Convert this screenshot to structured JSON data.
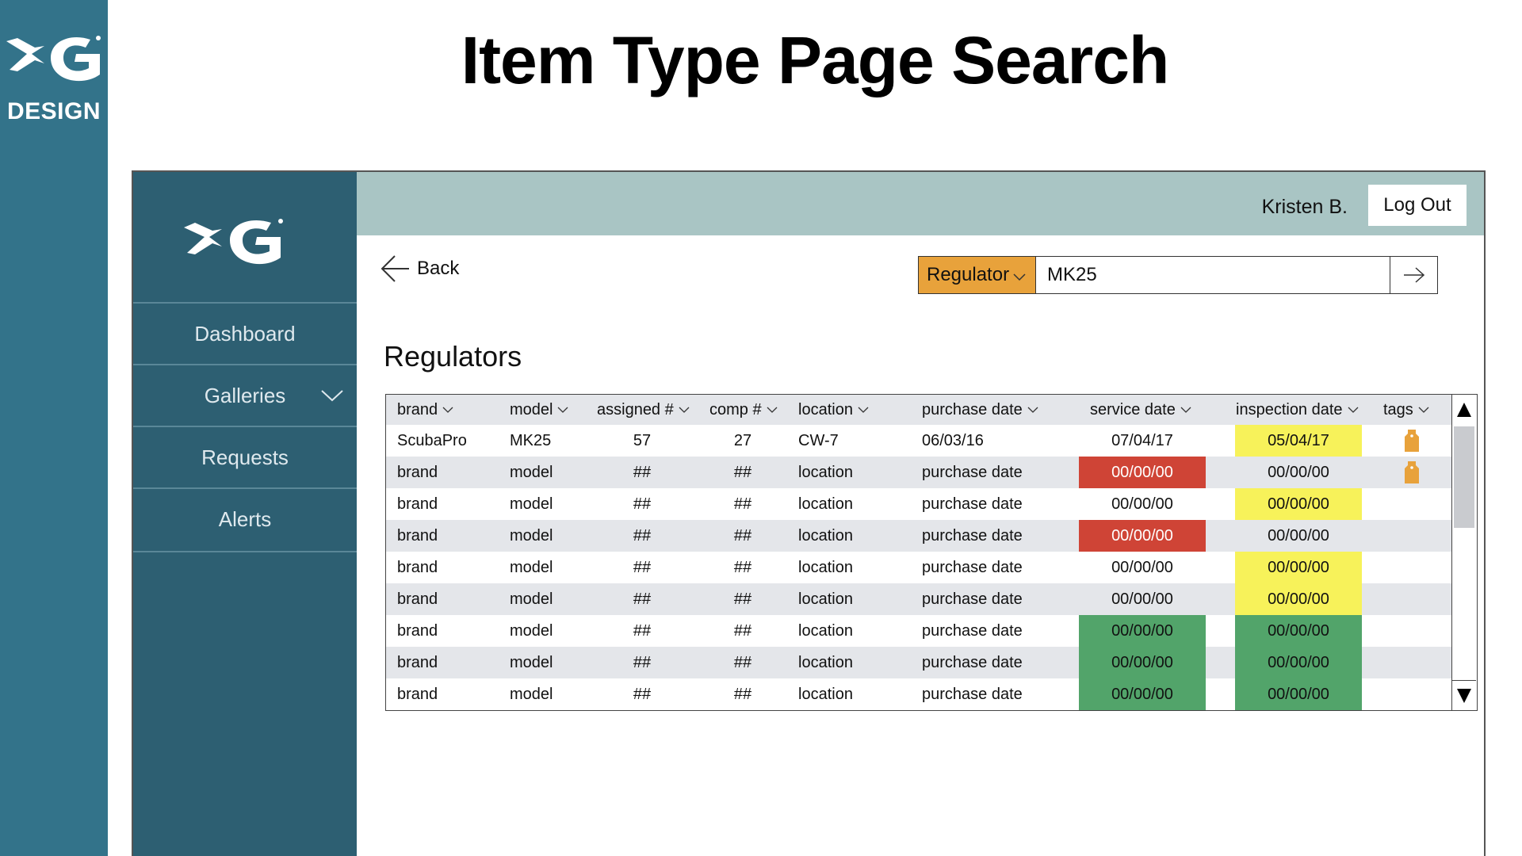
{
  "brand": {
    "text": "DESIGN"
  },
  "slide": {
    "title": "Item Type Page Search"
  },
  "header": {
    "user": "Kristen B.",
    "logout_label": "Log Out"
  },
  "sidebar": {
    "items": [
      {
        "label": "Dashboard"
      },
      {
        "label": "Galleries"
      },
      {
        "label": "Requests"
      },
      {
        "label": "Alerts"
      }
    ]
  },
  "nav": {
    "back_label": "Back"
  },
  "search": {
    "category": "Regulator",
    "value": "MK25"
  },
  "section": {
    "title": "Regulators"
  },
  "table": {
    "columns": [
      "brand",
      "model",
      "assigned #",
      "comp #",
      "location",
      "purchase date",
      "service date",
      "inspection date",
      "tags"
    ],
    "rows": [
      {
        "brand": "ScubaPro",
        "model": "MK25",
        "assigned": "57",
        "comp": "27",
        "location": "CW-7",
        "purchase": "06/03/16",
        "service": "07/04/17",
        "service_status": "none",
        "inspection": "05/04/17",
        "inspection_status": "yellow",
        "tag": true
      },
      {
        "brand": "brand",
        "model": "model",
        "assigned": "##",
        "comp": "##",
        "location": "location",
        "purchase": "purchase date",
        "service": "00/00/00",
        "service_status": "red",
        "inspection": "00/00/00",
        "inspection_status": "none",
        "tag": true
      },
      {
        "brand": "brand",
        "model": "model",
        "assigned": "##",
        "comp": "##",
        "location": "location",
        "purchase": "purchase date",
        "service": "00/00/00",
        "service_status": "none",
        "inspection": "00/00/00",
        "inspection_status": "yellow",
        "tag": false
      },
      {
        "brand": "brand",
        "model": "model",
        "assigned": "##",
        "comp": "##",
        "location": "location",
        "purchase": "purchase date",
        "service": "00/00/00",
        "service_status": "red",
        "inspection": "00/00/00",
        "inspection_status": "none",
        "tag": false
      },
      {
        "brand": "brand",
        "model": "model",
        "assigned": "##",
        "comp": "##",
        "location": "location",
        "purchase": "purchase date",
        "service": "00/00/00",
        "service_status": "none",
        "inspection": "00/00/00",
        "inspection_status": "yellow",
        "tag": false
      },
      {
        "brand": "brand",
        "model": "model",
        "assigned": "##",
        "comp": "##",
        "location": "location",
        "purchase": "purchase date",
        "service": "00/00/00",
        "service_status": "none",
        "inspection": "00/00/00",
        "inspection_status": "yellow",
        "tag": false
      },
      {
        "brand": "brand",
        "model": "model",
        "assigned": "##",
        "comp": "##",
        "location": "location",
        "purchase": "purchase date",
        "service": "00/00/00",
        "service_status": "green",
        "inspection": "00/00/00",
        "inspection_status": "green",
        "tag": false
      },
      {
        "brand": "brand",
        "model": "model",
        "assigned": "##",
        "comp": "##",
        "location": "location",
        "purchase": "purchase date",
        "service": "00/00/00",
        "service_status": "green",
        "inspection": "00/00/00",
        "inspection_status": "green",
        "tag": false
      },
      {
        "brand": "brand",
        "model": "model",
        "assigned": "##",
        "comp": "##",
        "location": "location",
        "purchase": "purchase date",
        "service": "00/00/00",
        "service_status": "green",
        "inspection": "00/00/00",
        "inspection_status": "green",
        "tag": false
      }
    ]
  },
  "colors": {
    "brand_teal": "#33738a",
    "sidebar": "#2d5f72",
    "topbar": "#a9c5c4",
    "accent_orange": "#e8a23b",
    "status_red": "#cf4436",
    "status_yellow": "#f7f25a",
    "status_green": "#52a46a"
  },
  "icons": {
    "logo": "fish-g-logo-icon",
    "back": "arrow-left-icon",
    "go": "arrow-right-icon",
    "dropdown": "chevron-down-icon",
    "tag": "tag-icon",
    "scroll_up": "triangle-up-icon",
    "scroll_down": "triangle-down-icon"
  }
}
